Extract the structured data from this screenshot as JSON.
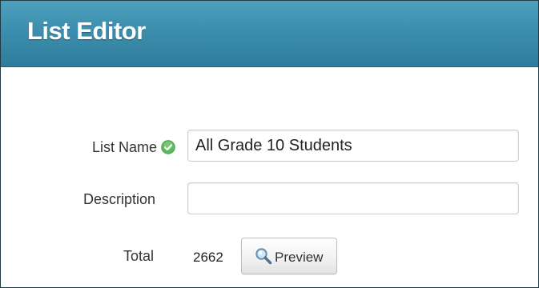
{
  "header": {
    "title": "List Editor"
  },
  "form": {
    "list_name": {
      "label": "List Name",
      "value": "All Grade 10 Students",
      "status_icon": "check-circle-icon",
      "status_color": "#5cb85c"
    },
    "description": {
      "label": "Description",
      "value": ""
    },
    "total": {
      "label": "Total",
      "value": "2662"
    },
    "preview_button": {
      "label": "Preview",
      "icon": "magnifier-icon"
    }
  },
  "colors": {
    "header_top": "#4d9fbd",
    "header_bottom": "#2e7c9c"
  }
}
